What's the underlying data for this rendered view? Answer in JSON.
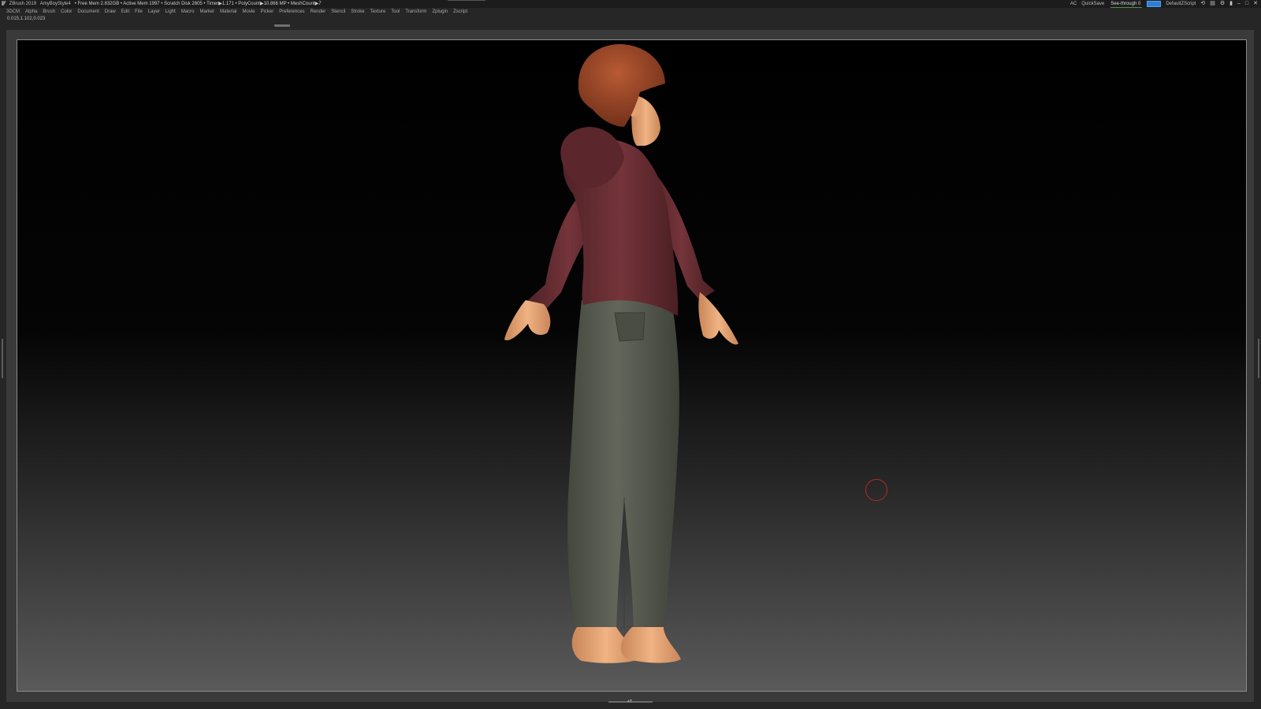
{
  "titlebar": {
    "app": "ZBrush 2019",
    "document": "AmyBoyStyle4",
    "mem_info": "• Free Mem 2.832GB • Active Mem 1997 • Scratch Disk 2805 • Timer▶1.171 • PolyCount▶10.866 MP • MeshCount▶7",
    "ac_label": "AC",
    "quicksave_label": "QuickSave",
    "see_through_label": "See-through  0",
    "script_label": "DefaultZScript"
  },
  "menu": [
    "3DCM",
    "Alpha",
    "Brush",
    "Color",
    "Document",
    "Draw",
    "Edit",
    "File",
    "Layer",
    "Light",
    "Macro",
    "Marker",
    "Material",
    "Movie",
    "Picker",
    "Preferences",
    "Render",
    "Stencil",
    "Stroke",
    "Texture",
    "Tool",
    "Transform",
    "Zplugin",
    "Zscript"
  ],
  "coords": "0.015,1.102,0.023",
  "icons": {
    "logo": "zbrush-logo-icon",
    "window_controls": [
      "layout-icon",
      "menus-icon",
      "settings-icon",
      "help-icon",
      "minimize-icon",
      "restore-icon",
      "close-icon"
    ]
  },
  "colors": {
    "hoodie": "#6b2e34",
    "pants": "#55584e",
    "skin": "#e9a877",
    "hair": "#9a4426",
    "brush_cursor": "#b52a20"
  }
}
